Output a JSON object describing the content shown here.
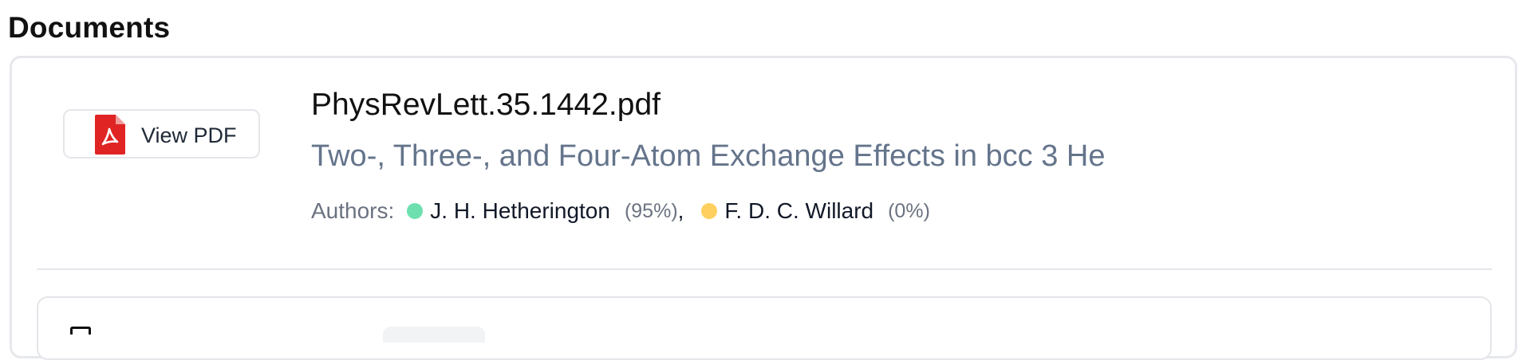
{
  "section": {
    "title": "Documents"
  },
  "documents": [
    {
      "view_button_label": "View PDF",
      "file_name": "PhysRevLett.35.1442.pdf",
      "title": "Two-, Three-, and Four-Atom Exchange Effects in bcc 3 He",
      "authors_label": "Authors:",
      "authors": [
        {
          "name": "J. H. Hetherington",
          "percent": "(95%)",
          "dot_color": "#6ee0b0"
        },
        {
          "name": "F. D. C. Willard",
          "percent": "(0%)",
          "dot_color": "#ffd060"
        }
      ],
      "author_separator": ","
    }
  ],
  "colors": {
    "pdf_red": "#e02424",
    "title_gray": "#64748b",
    "border": "#e4e6ea"
  },
  "icons": [
    "pdf-file-icon"
  ]
}
